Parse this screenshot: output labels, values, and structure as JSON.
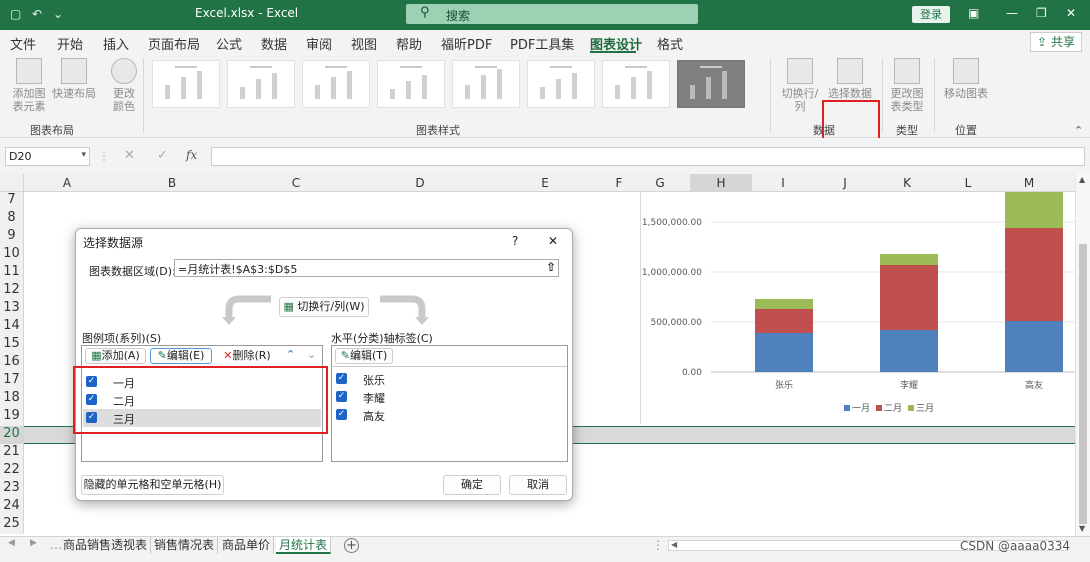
{
  "titlebar": {
    "title": "Excel.xlsx - Excel",
    "search_placeholder": "搜索",
    "login_label": "登录"
  },
  "menu": {
    "items": [
      "文件",
      "开始",
      "插入",
      "页面布局",
      "公式",
      "数据",
      "审阅",
      "视图",
      "帮助",
      "福昕PDF",
      "PDF工具集",
      "图表设计",
      "格式"
    ],
    "active": "图表设计",
    "share_label": "共享"
  },
  "ribbon": {
    "add_chart_element": "添加图表元素",
    "quick_layout": "快速布局",
    "change_colors": "更改颜色",
    "group_chart_layout": "图表布局",
    "group_chart_styles": "图表样式",
    "switch_row_col": "切换行/列",
    "select_data": "选择数据",
    "group_data": "数据",
    "change_chart_type": "更改图表类型",
    "group_type": "类型",
    "move_chart": "移动图表",
    "group_location": "位置"
  },
  "formula_bar": {
    "name_box": "D20",
    "fx": "fx",
    "content": ""
  },
  "sheet": {
    "columns": [
      "A",
      "B",
      "C",
      "D",
      "E",
      "F",
      "G",
      "H",
      "I",
      "J",
      "K",
      "L",
      "M"
    ],
    "rows": [
      "7",
      "8",
      "9",
      "10",
      "11",
      "12",
      "13",
      "14",
      "15",
      "16",
      "17",
      "18",
      "19",
      "20",
      "21",
      "22",
      "23",
      "24",
      "25"
    ],
    "selected_row": "20",
    "tabs": [
      "商品销售透视表",
      "销售情况表",
      "商品单价",
      "月统计表"
    ],
    "active_tab": "月统计表"
  },
  "chart_data": {
    "type": "bar",
    "stacked": true,
    "categories": [
      "张乐",
      "李耀",
      "高友"
    ],
    "series": [
      {
        "name": "一月",
        "color": "#4f81bd",
        "values": [
          390000,
          420000,
          510000
        ]
      },
      {
        "name": "二月",
        "color": "#c0504d",
        "values": [
          240000,
          650000,
          930000
        ]
      },
      {
        "name": "三月",
        "color": "#9bbb59",
        "values": [
          100000,
          110000,
          360000
        ]
      }
    ],
    "y_ticks": [
      "0.00",
      "500,000.00",
      "1,000,000.00",
      "1,500,000.00"
    ],
    "ylim": [
      0,
      1700000
    ],
    "legend_position": "bottom"
  },
  "dialog": {
    "title": "选择数据源",
    "help": "?",
    "close": "✕",
    "range_label": "图表数据区域(D):",
    "range_value": "=月统计表!$A$3:$D$5",
    "switch_button": "切换行/列(W)",
    "legend_header": "图例项(系列)(S)",
    "add_button": "添加(A)",
    "edit_button": "编辑(E)",
    "delete_button": "删除(R)",
    "series_items": [
      "一月",
      "二月",
      "三月"
    ],
    "axis_header": "水平(分类)轴标签(C)",
    "axis_edit_button": "编辑(T)",
    "axis_items": [
      "张乐",
      "李耀",
      "高友"
    ],
    "hidden_cells_button": "隐藏的单元格和空单元格(H)",
    "ok_button": "确定",
    "cancel_button": "取消"
  },
  "watermark": "CSDN @aaaa0334"
}
